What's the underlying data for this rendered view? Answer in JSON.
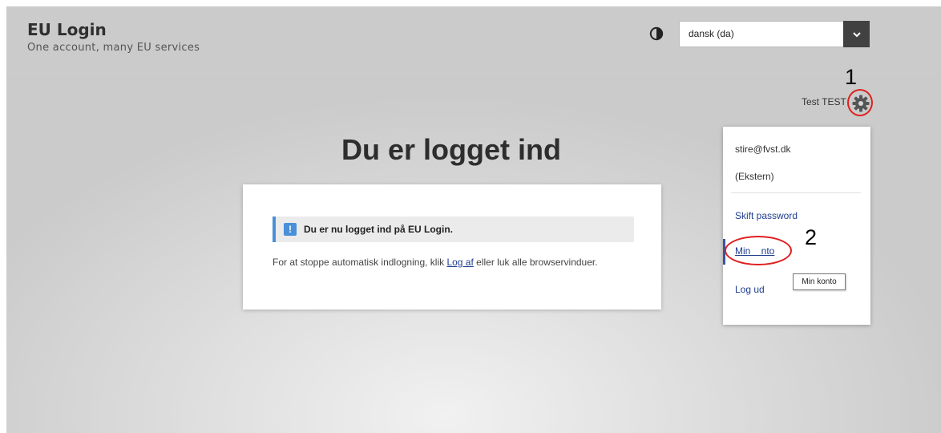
{
  "header": {
    "app_title": "EU Login",
    "app_subtitle": "One account, many EU services",
    "language": "dansk (da)",
    "icons": [
      "contrast-icon",
      "chevron-down-icon",
      "gear-icon"
    ]
  },
  "user": {
    "name": "Test TEST",
    "email": "stire@fvst.dk",
    "type": "(Ekstern)"
  },
  "menu": {
    "change_password": "Skift password",
    "my_account": "Min    nto",
    "logout": "Log ud",
    "tooltip": "Min konto"
  },
  "main": {
    "heading": "Du er logget ind",
    "notice": "Du er nu logget ind på EU Login.",
    "info_before": "For at stoppe automatisk indlogning, klik ",
    "info_link": "Log af",
    "info_after": " eller luk alle browservinduer."
  },
  "annotations": {
    "step1": "1",
    "step2": "2"
  },
  "colors": {
    "link": "#1e3d8f",
    "annotation": "#e01f1f",
    "notice_accent": "#4a90d9",
    "select_button": "#414141"
  }
}
